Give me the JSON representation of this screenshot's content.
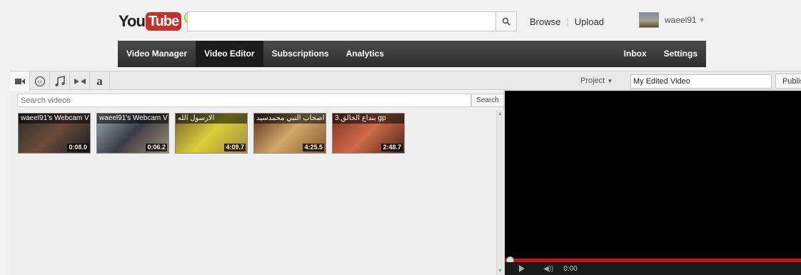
{
  "masthead": {
    "logo_you": "You",
    "logo_tube": "Tube",
    "search_placeholder": "",
    "links": [
      "Browse",
      "Upload"
    ],
    "username": "waeel91"
  },
  "nav": {
    "left": [
      "Video Manager",
      "Video Editor",
      "Subscriptions",
      "Analytics"
    ],
    "right": [
      "Inbox",
      "Settings"
    ],
    "active": "Video Editor"
  },
  "toolbar": {
    "icons": [
      "video-camera-icon",
      "captions-icon",
      "music-note-icon",
      "transitions-icon",
      "text-icon"
    ],
    "text_icon_glyph": "a",
    "project_label": "Project",
    "project_name": "My Edited Video",
    "publish_label": "Publish"
  },
  "videos_panel": {
    "search_placeholder": "Search videos",
    "search_button": "Search",
    "videos": [
      {
        "title": "waeel91's Webcam V",
        "duration": "0:08.0",
        "colors": [
          "#2e2a2c",
          "#6b4c3a",
          "#1b1b1f"
        ]
      },
      {
        "title": "waeel91's Webcam V",
        "duration": "0:06.2",
        "colors": [
          "#9aa9b6",
          "#3b3d43",
          "#a08d78"
        ]
      },
      {
        "title": "الارسول الله",
        "duration": "4:09.7",
        "colors": [
          "#7b5f2b",
          "#d9cf3a",
          "#a68c3f"
        ]
      },
      {
        "title": "اصحاب النبي محمدسيد",
        "duration": "4:25.5",
        "colors": [
          "#5a2f1a",
          "#d1a86a",
          "#8a5a2e"
        ]
      },
      {
        "title": "3.بنداع الخالق gp",
        "duration": "2:48.7",
        "colors": [
          "#7a3120",
          "#cf6b4a",
          "#4c2417"
        ]
      }
    ]
  },
  "player": {
    "time": "0:00"
  }
}
